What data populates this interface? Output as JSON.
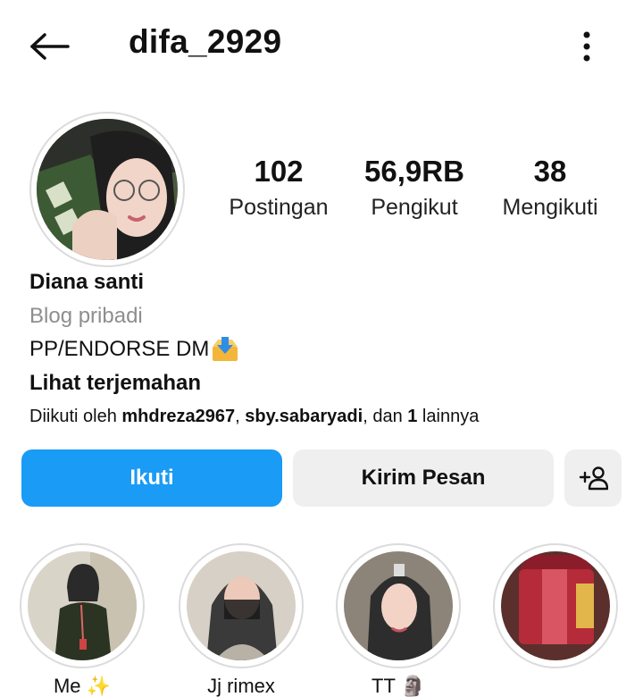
{
  "header": {
    "username": "difa_2929",
    "back_icon": "arrow-left-icon",
    "more_icon": "more-vertical-icon"
  },
  "profile": {
    "stats": [
      {
        "value": "102",
        "label": "Postingan"
      },
      {
        "value": "56,9RB",
        "label": "Pengikut"
      },
      {
        "value": "38",
        "label": "Mengikuti"
      }
    ],
    "name": "Diana santi",
    "category": "Blog pribadi",
    "bio": "PP/ENDORSE DM",
    "bio_emoji_icon": "inbox-tray-icon",
    "translate_label": "Lihat terjemahan",
    "followed_by": {
      "prefix": "Diikuti oleh ",
      "user1": "mhdreza2967",
      "sep": ", ",
      "user2": "sby.sabaryadi",
      "mid": ", dan ",
      "count": "1",
      "suffix": " lainnya"
    }
  },
  "actions": {
    "follow_label": "Ikuti",
    "message_label": "Kirim Pesan",
    "add_user_icon": "person-plus-icon"
  },
  "highlights": [
    {
      "label": "Me ✨"
    },
    {
      "label": "Jj rimex"
    },
    {
      "label": "TT 🗿"
    },
    {
      "label": ""
    }
  ],
  "colors": {
    "follow_button": "#1a9bf5",
    "secondary_button": "#efefef",
    "muted_text": "#8e8e8e",
    "ring": "#dbdbdb"
  }
}
